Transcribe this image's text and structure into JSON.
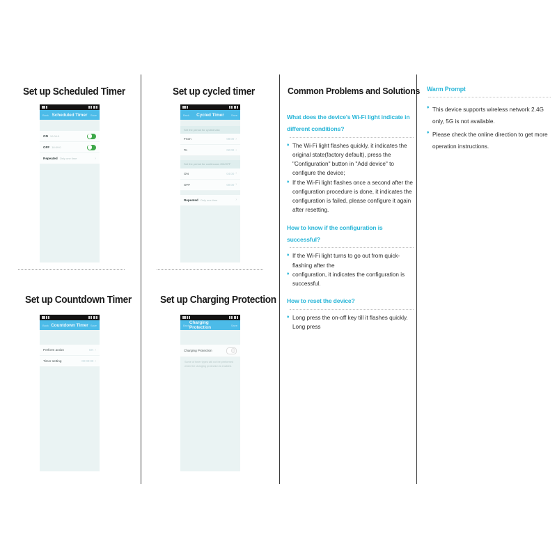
{
  "sections": {
    "scheduled": {
      "title": "Set up Scheduled Timer",
      "phone": {
        "back": "Back",
        "title": "Scheduled Timer",
        "save": "Save",
        "rows": [
          {
            "label": "ON",
            "value": "10:04:0",
            "type": "toggle"
          },
          {
            "label": "OFF",
            "value": "18:09:0",
            "type": "toggle"
          },
          {
            "label": "Repeated",
            "sub": "Only one time",
            "value": "",
            "type": "chevron"
          }
        ]
      }
    },
    "cycled": {
      "title": "Set up cycled timer",
      "phone": {
        "back": "Back",
        "title": "Cycled Timer",
        "save": "Save",
        "group1": "Set the period for cycled task",
        "group2": "Set the period for continuous ON/OFF",
        "rows": [
          {
            "label": "From",
            "value": "08:00"
          },
          {
            "label": "To",
            "value": "02:00"
          },
          {
            "label": "ON",
            "value": "04:00"
          },
          {
            "label": "OFF",
            "value": "00:00"
          },
          {
            "label": "Repeated",
            "sub": "Only one time",
            "value": ""
          }
        ]
      }
    },
    "countdown": {
      "title": "Set up Countdown Timer",
      "phone": {
        "back": "Back",
        "title": "Countdown Timer",
        "save": "Save",
        "rows": [
          {
            "label": "Perform action",
            "value": "ON"
          },
          {
            "label": "Timer setting",
            "value": "00:00:00"
          }
        ]
      }
    },
    "charging": {
      "title": "Set up Charging Protection",
      "phone": {
        "back": "Back",
        "title": "Charging Protection",
        "save": "Save",
        "rows": [
          {
            "label": "Charging Protection",
            "value": "",
            "type": "toggle-off"
          }
        ],
        "note": "Some of timer types will not be performed when the charging protection is enabled."
      }
    }
  },
  "problems": {
    "heading": "Common Problems and Solutions",
    "blocks": [
      {
        "question": "What does the device's Wi-Fi light indicate in different conditions?",
        "answers": [
          "The Wi-Fi light flashes quickly, it indicates the original state(factory default), press the \"Configuration\" button in \"Add device\" to configure the device;",
          "If the Wi-Fi light flashes once a second after the configuration procedure is done, it indicates the configuration is failed, please configure it again after resetting."
        ]
      },
      {
        "question": "How to know if the configuration is successful?",
        "answers": [
          "If the Wi-Fi light turns to go out from quick-flashing after the",
          "configuration, it indicates the configuration is successful."
        ]
      },
      {
        "question": "How to reset the device?",
        "answers": [
          "Long press the on-off key till it flashes quickly. Long press"
        ]
      }
    ]
  },
  "warm_prompt": {
    "heading": "Warm Prompt",
    "items": [
      "This device supports wireless network 2.4G only, 5G is not available.",
      "Please check the online direction to get more operation instructions."
    ]
  },
  "icons": {
    "bullet": "♦",
    "chevron": "›",
    "wifi": "wifi-icon",
    "signal": "signal-icon",
    "battery": "battery-icon"
  },
  "colors": {
    "accent": "#29b6d8",
    "phone_titlebar": "#4cbbe8",
    "toggle_on": "#3ea84a",
    "phone_bg": "#eaf3f3"
  }
}
